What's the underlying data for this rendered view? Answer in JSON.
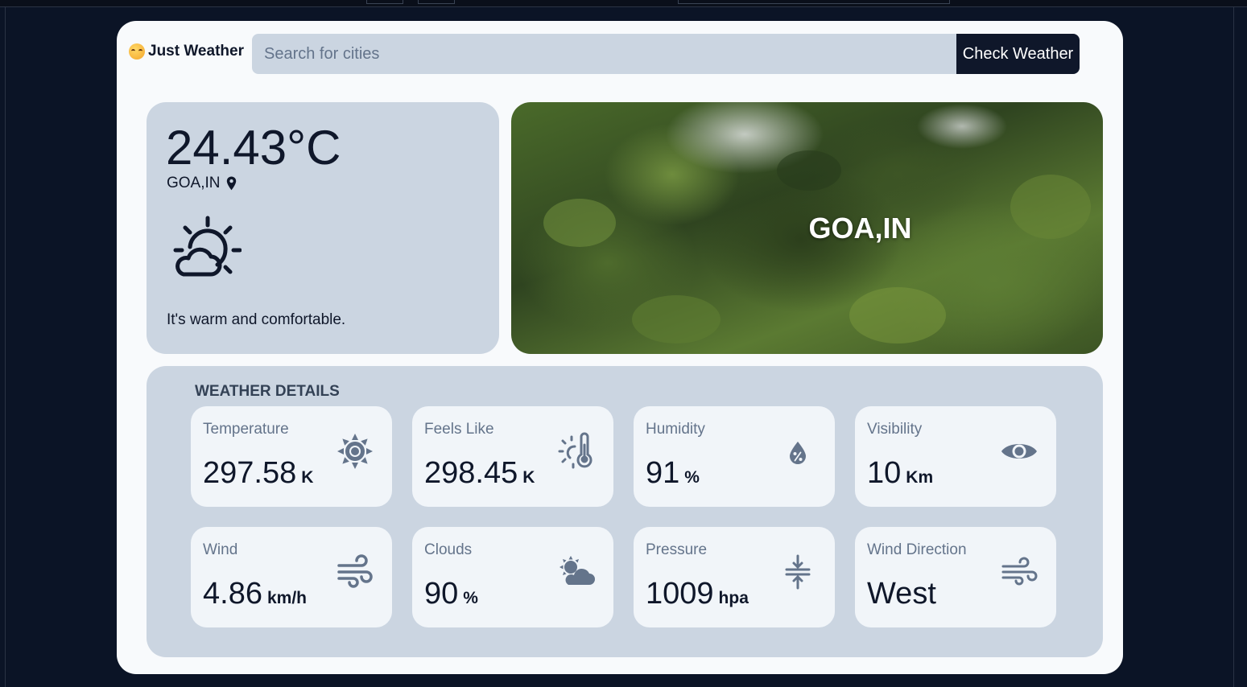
{
  "app": {
    "title": "Just Weather",
    "logo_icon": "smiling-sun-emoji-icon"
  },
  "search": {
    "placeholder": "Search for cities",
    "button_label": "Check Weather"
  },
  "current": {
    "temperature": "24.43°C",
    "location": "GOA,IN",
    "location_icon": "map-pin-icon",
    "condition_icon": "partly-cloudy-sun-icon",
    "description": "It's warm and comfortable."
  },
  "hero": {
    "city_label": "GOA,IN"
  },
  "details": {
    "title": "WEATHER DETAILS",
    "tiles": [
      {
        "label": "Temperature",
        "value": "297.58",
        "unit": "K",
        "icon": "sun-icon"
      },
      {
        "label": "Feels Like",
        "value": "298.45",
        "unit": "K",
        "icon": "thermometer-sun-icon"
      },
      {
        "label": "Humidity",
        "value": "91",
        "unit": "%",
        "icon": "humidity-drop-icon"
      },
      {
        "label": "Visibility",
        "value": "10",
        "unit": "Km",
        "icon": "eye-icon"
      },
      {
        "label": "Wind",
        "value": "4.86",
        "unit": "km/h",
        "icon": "wind-icon"
      },
      {
        "label": "Clouds",
        "value": "90",
        "unit": "%",
        "icon": "cloud-sun-icon"
      },
      {
        "label": "Pressure",
        "value": "1009",
        "unit": "hpa",
        "icon": "pressure-compress-icon"
      },
      {
        "label": "Wind Direction",
        "value": "West",
        "unit": "",
        "icon": "wind-direction-icon"
      }
    ]
  },
  "colors": {
    "page_bg": "#0b1426",
    "card_bg": "#f8fafc",
    "panel_bg": "#cbd5e1",
    "tile_bg": "#f1f5f9",
    "button_bg": "#0f172a",
    "icon_color": "#64748b"
  }
}
